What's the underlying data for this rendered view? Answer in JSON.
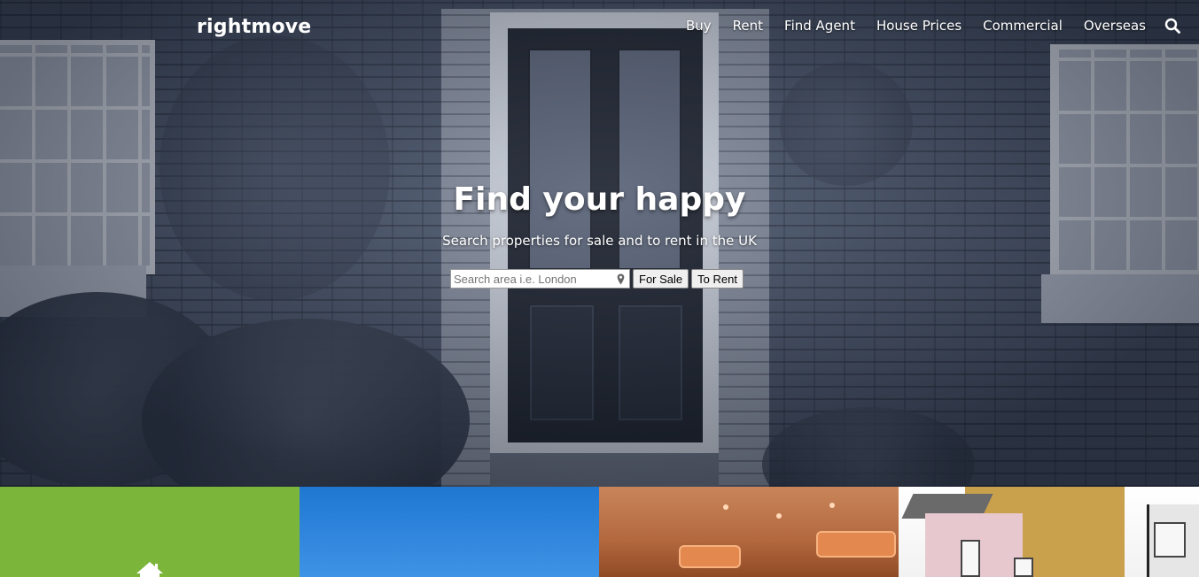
{
  "header": {
    "logo": "rightmove",
    "nav": [
      "Buy",
      "Rent",
      "Find Agent",
      "House Prices",
      "Commercial",
      "Overseas"
    ],
    "search_icon": "search-icon"
  },
  "hero": {
    "headline": "Find your happy",
    "subline": "Search properties for sale and to rent in the UK",
    "search": {
      "placeholder": "Search area i.e. London",
      "value": ""
    },
    "buttons": {
      "for_sale": "For Sale",
      "to_rent": "To Rent"
    }
  },
  "tiles": [
    {
      "icon": "house-icon",
      "color": "#7bb53a"
    },
    {
      "color": "#1f77d1"
    },
    {
      "color": "#c9855a"
    },
    {
      "color": "#ffffff"
    }
  ]
}
